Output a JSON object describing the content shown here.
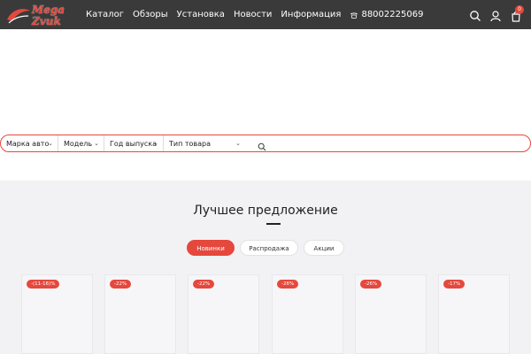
{
  "header": {
    "logo_line1": "Mega",
    "logo_line2": "Zvuk",
    "nav": [
      "Каталог",
      "Обзоры",
      "Установка",
      "Новости",
      "Информация"
    ],
    "phone": "88002225069",
    "cart_count": "0",
    "icons": [
      "search-icon",
      "user-icon",
      "cart-icon"
    ]
  },
  "filter": {
    "brand": "Марка авто",
    "model": "Модель",
    "year": "Год выпуска",
    "type": "Тип товара"
  },
  "offers": {
    "title": "Лучшее предложение",
    "tabs": [
      {
        "label": "Новинки",
        "active": true
      },
      {
        "label": "Распродажа",
        "active": false
      },
      {
        "label": "Акции",
        "active": false
      }
    ],
    "badges": [
      "-(11-16)%",
      "-22%",
      "-22%",
      "-26%",
      "-26%",
      "-17%"
    ]
  },
  "colors": {
    "accent": "#e5483d",
    "header_bg": "#3a3a3a",
    "section_bg": "#f2f2f4"
  }
}
